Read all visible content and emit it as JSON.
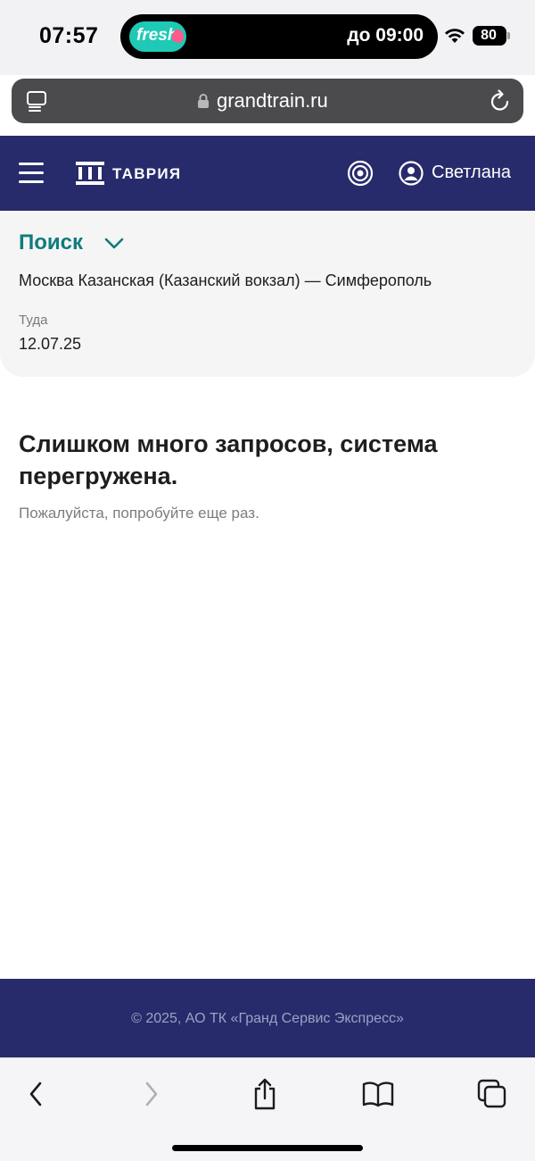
{
  "status_bar": {
    "time": "07:57",
    "live_activity": {
      "app": "fresh",
      "text": "до 09:00"
    },
    "battery": "80"
  },
  "browser": {
    "url": "grandtrain.ru"
  },
  "header": {
    "logo": "ТАВРИЯ",
    "user_name": "Светлана"
  },
  "search": {
    "title": "Поиск",
    "route": "Москва Казанская (Казанский вокзал) — Симферополь",
    "direction_label": "Туда",
    "date": "12.07.25"
  },
  "error": {
    "title": "Слишком много запросов, система перегружена.",
    "subtitle": "Пожалуйста, попробуйте еще раз."
  },
  "footer": {
    "copyright": "© 2025, АО ТК «Гранд Сервис Экспресс»"
  },
  "colors": {
    "brand_navy": "#272b6b",
    "accent_teal": "#0f7c7e"
  },
  "icons": [
    "tabs-view-icon",
    "lock-icon",
    "reload-icon",
    "menu-icon",
    "accessibility-icon",
    "user-icon",
    "chevron-down-icon",
    "back-icon",
    "forward-icon",
    "share-icon",
    "bookmarks-icon",
    "tabs-icon"
  ]
}
